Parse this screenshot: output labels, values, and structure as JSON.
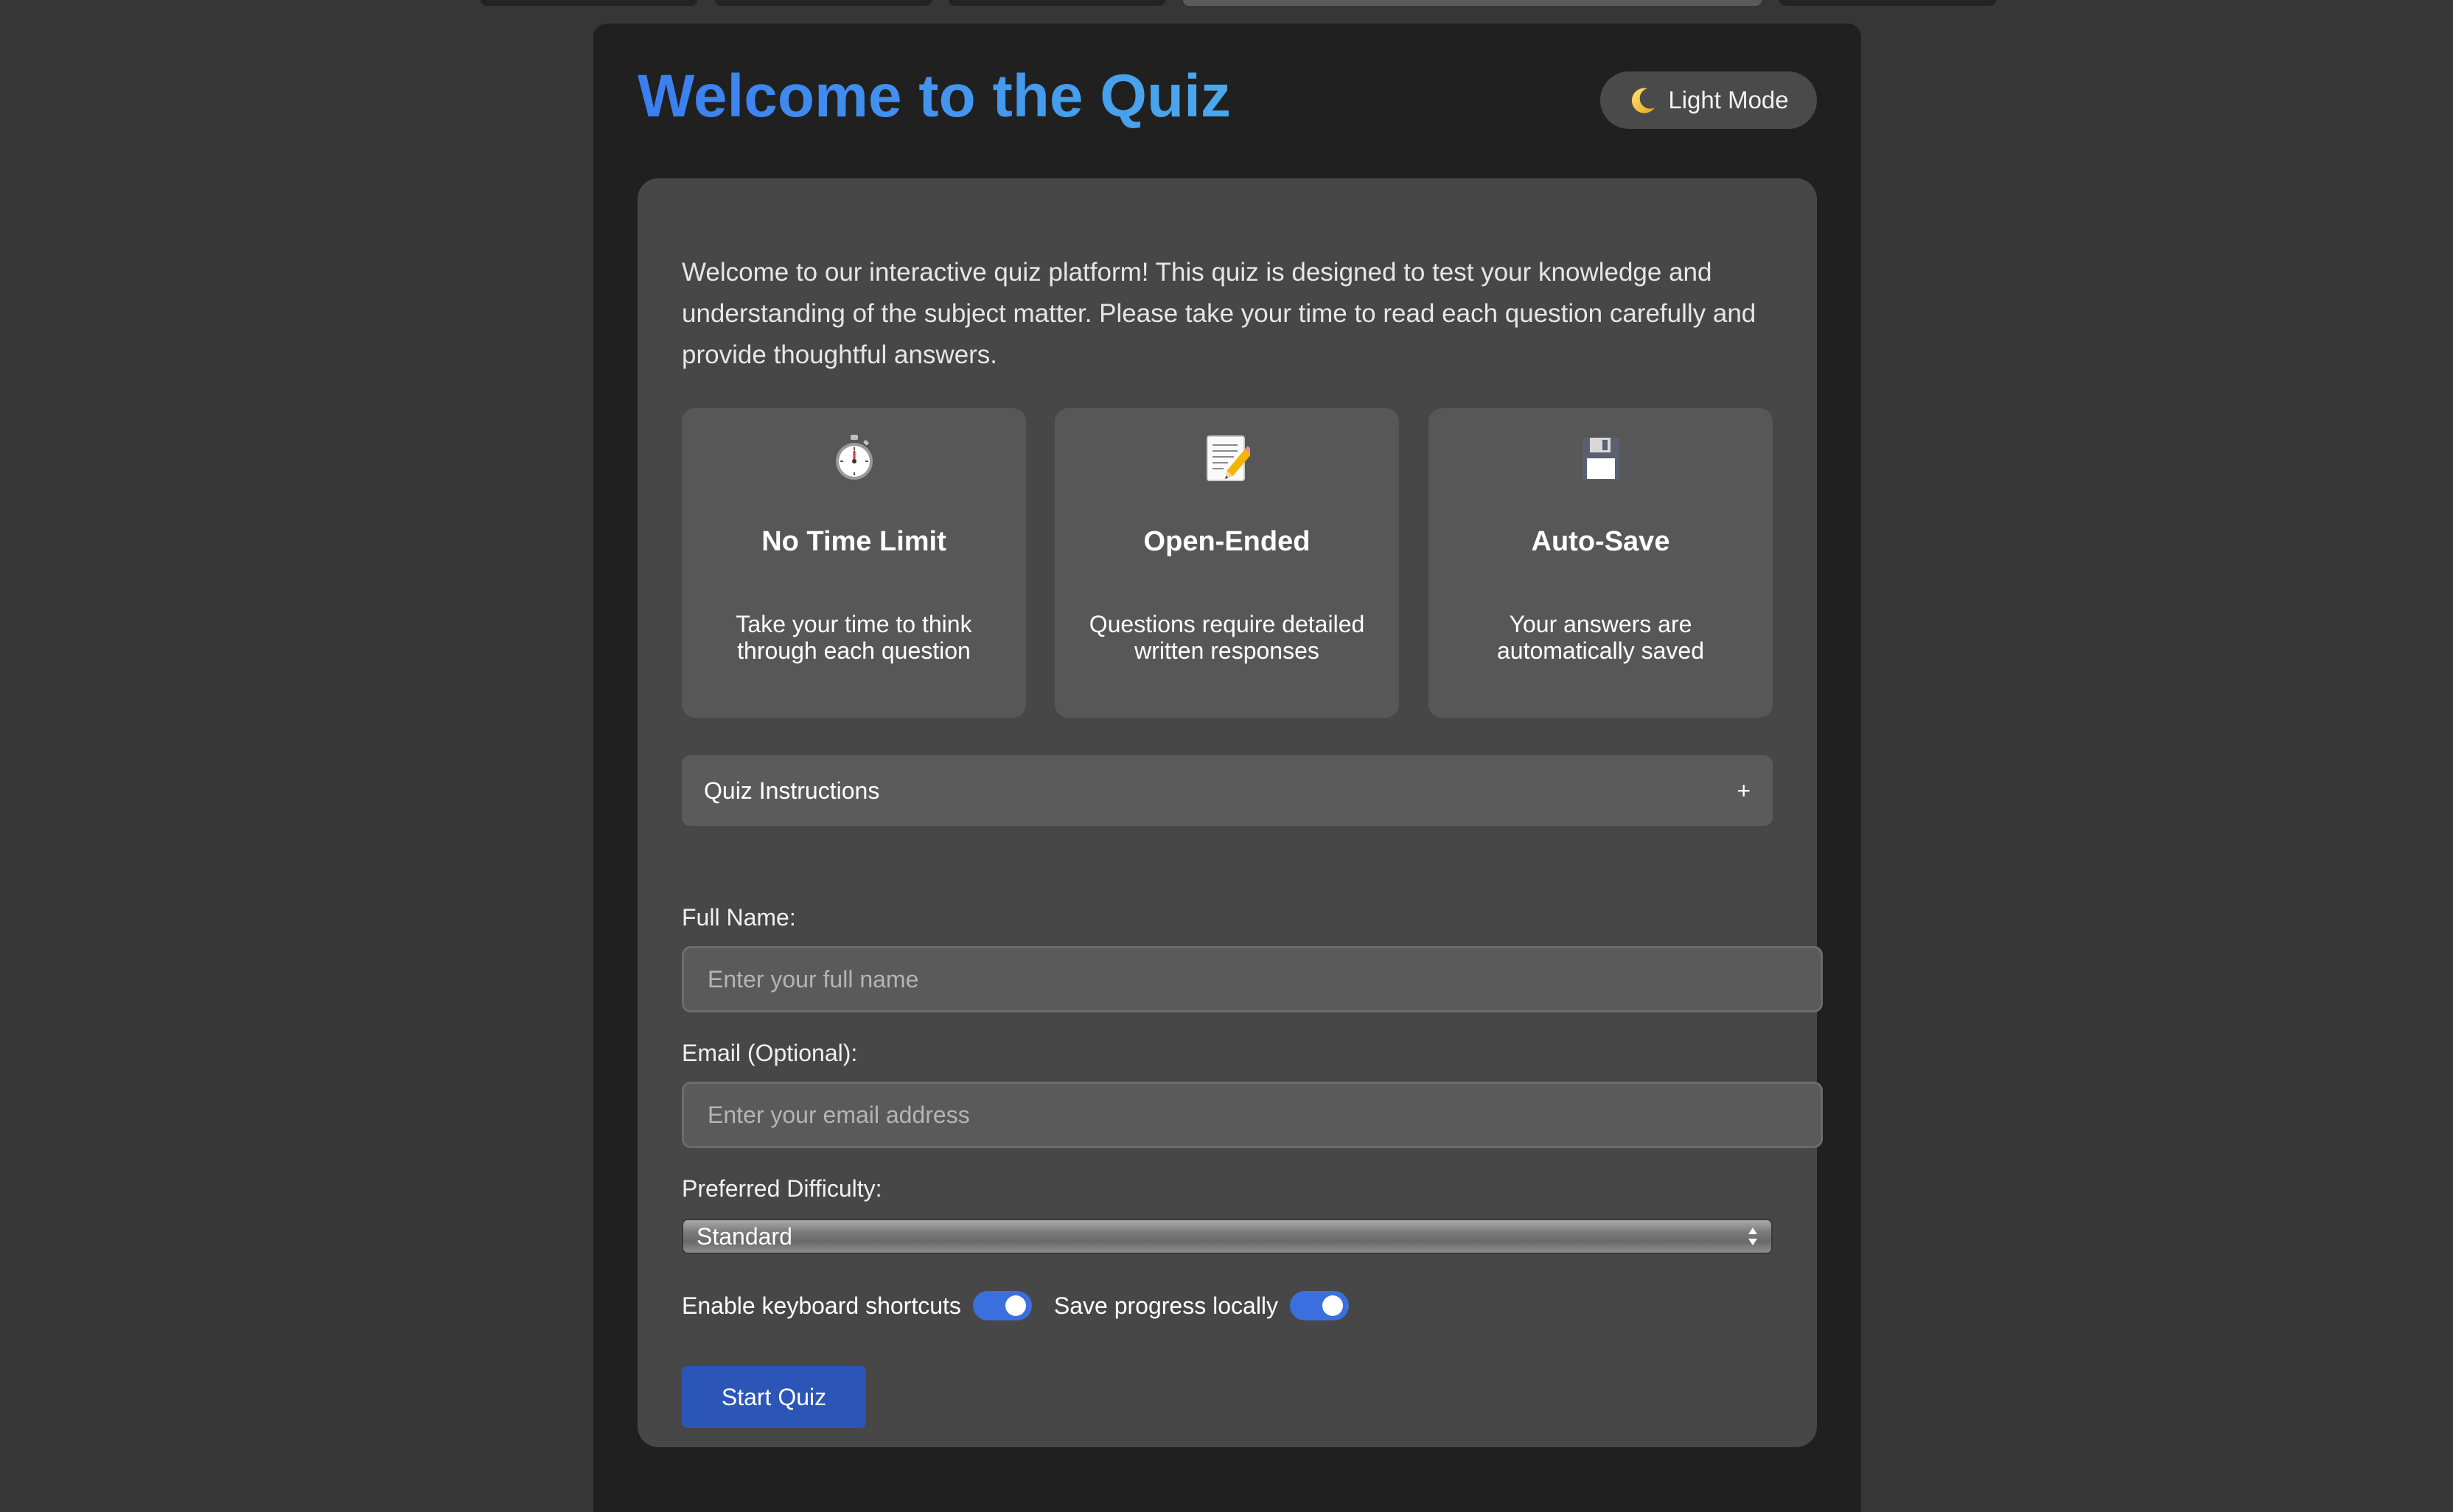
{
  "header": {
    "title": "Welcome to the Quiz",
    "theme_toggle_label": "Light Mode",
    "theme_toggle_icon": "moon-icon"
  },
  "intro_text": "Welcome to our interactive quiz platform! This quiz is designed to test your knowledge and understanding of the subject matter. Please take your time to read each question carefully and provide thoughtful answers.",
  "features": [
    {
      "icon": "stopwatch-icon",
      "title": "No Time Limit",
      "description": "Take your time to think through each question"
    },
    {
      "icon": "memo-icon",
      "title": "Open-Ended",
      "description": "Questions require detailed written responses"
    },
    {
      "icon": "floppy-disk-icon",
      "title": "Auto-Save",
      "description": "Your answers are automatically saved"
    }
  ],
  "instructions": {
    "label": "Quiz Instructions",
    "toggle_symbol": "+"
  },
  "form": {
    "name": {
      "label": "Full Name:",
      "placeholder": "Enter your full name",
      "value": ""
    },
    "email": {
      "label": "Email (Optional):",
      "placeholder": "Enter your email address",
      "value": ""
    },
    "difficulty": {
      "label": "Preferred Difficulty:",
      "selected": "Standard"
    },
    "toggles": [
      {
        "label": "Enable keyboard shortcuts",
        "on": true
      },
      {
        "label": "Save progress locally",
        "on": true
      }
    ],
    "start_label": "Start Quiz"
  },
  "colors": {
    "accent": "#3b6fe0",
    "title_gradient_start": "#3b7ef0",
    "title_gradient_end": "#4aa9ec",
    "button": "#2b56b8"
  }
}
